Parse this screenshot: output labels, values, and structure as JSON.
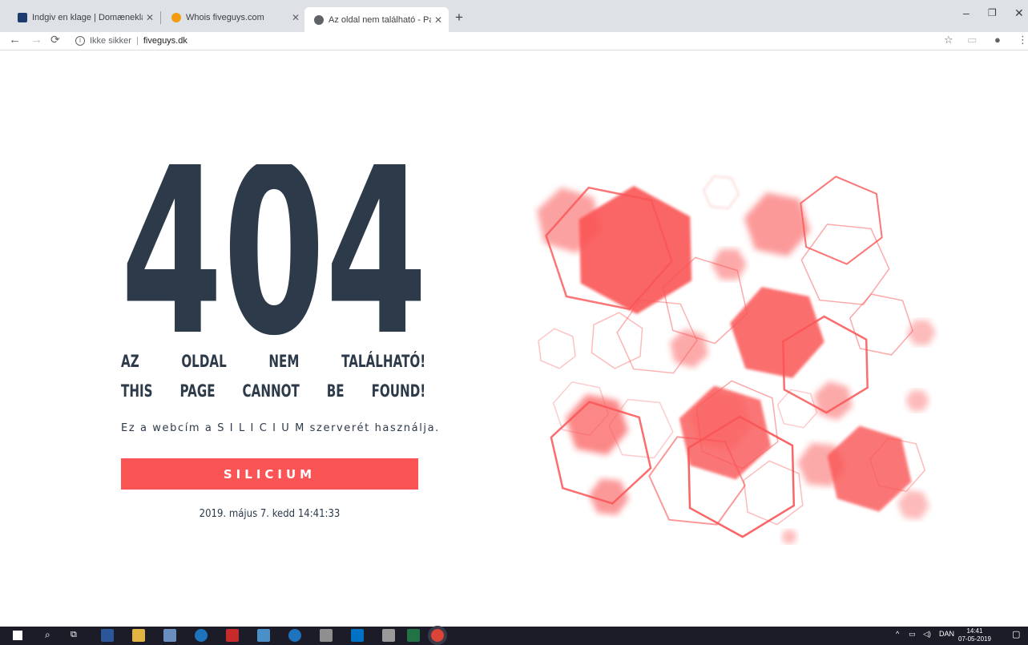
{
  "browser": {
    "tabs": [
      {
        "title": "Indgiv en klage | Domæneklager",
        "active": false,
        "favicon_color": "#1d3b6e"
      },
      {
        "title": "Whois fiveguys.com",
        "active": false,
        "favicon_color": "#f39c12"
      },
      {
        "title": "Az oldal nem található - Page no",
        "active": true,
        "favicon_color": "#5f6368"
      }
    ],
    "new_tab": "+",
    "security_label": "Ikke sikker",
    "url": "fiveguys.dk"
  },
  "page": {
    "error_code": "404",
    "headline_hu": [
      "AZ",
      "OLDAL",
      "NEM",
      "TALÁLHATÓ!"
    ],
    "headline_en": [
      "THIS",
      "PAGE",
      "CANNOT",
      "BE",
      "FOUND!"
    ],
    "server_note": "Ez a webcím a S I L I C I U M szerverét használja.",
    "button_label": "SILICIUM",
    "datetime": "2019. május 7. kedd 14:41:33",
    "accent_color": "#fa5455",
    "text_color": "#2c3a4a"
  },
  "taskbar": {
    "tray_lang": "DAN",
    "clock_time": "14:41",
    "clock_date": "07-05-2019"
  }
}
